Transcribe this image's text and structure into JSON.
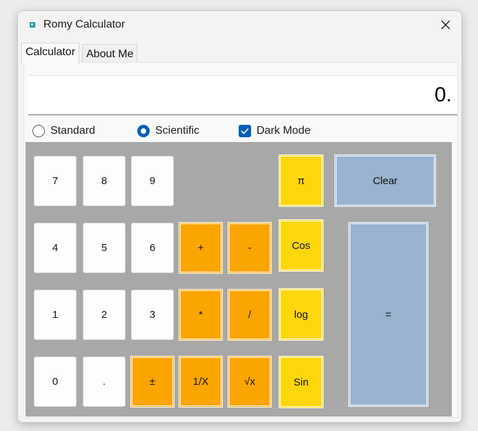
{
  "window": {
    "title": "Romy Calculator",
    "icon": "calculator-app-icon"
  },
  "tabs": [
    {
      "label": "Calculator",
      "active": true
    },
    {
      "label": "About Me",
      "active": false
    }
  ],
  "display": {
    "value": "0."
  },
  "modes": {
    "standard": {
      "label": "Standard",
      "selected": false
    },
    "scientific": {
      "label": "Scientific",
      "selected": true
    },
    "dark_mode": {
      "label": "Dark Mode",
      "checked": true
    }
  },
  "colors": {
    "keypad_background": "#a8a8a8",
    "digit_key": "#fdfdfd",
    "operator_key": "#fba500",
    "function_key": "#fdd60c",
    "clear_equals_key": "#99b3d1",
    "accent": "#005fb8"
  },
  "keys": {
    "seven": "7",
    "eight": "8",
    "nine": "9",
    "four": "4",
    "five": "5",
    "six": "6",
    "one": "1",
    "two": "2",
    "three": "3",
    "zero": "0",
    "decimal": ".",
    "plus": "+",
    "minus": "-",
    "multiply": "*",
    "divide": "/",
    "plus_minus": "±",
    "reciprocal": "1/X",
    "sqrt": "√x",
    "pi": "π",
    "cos": "Cos",
    "log": "log",
    "sin": "Sin",
    "clear": "Clear",
    "equals": "="
  }
}
